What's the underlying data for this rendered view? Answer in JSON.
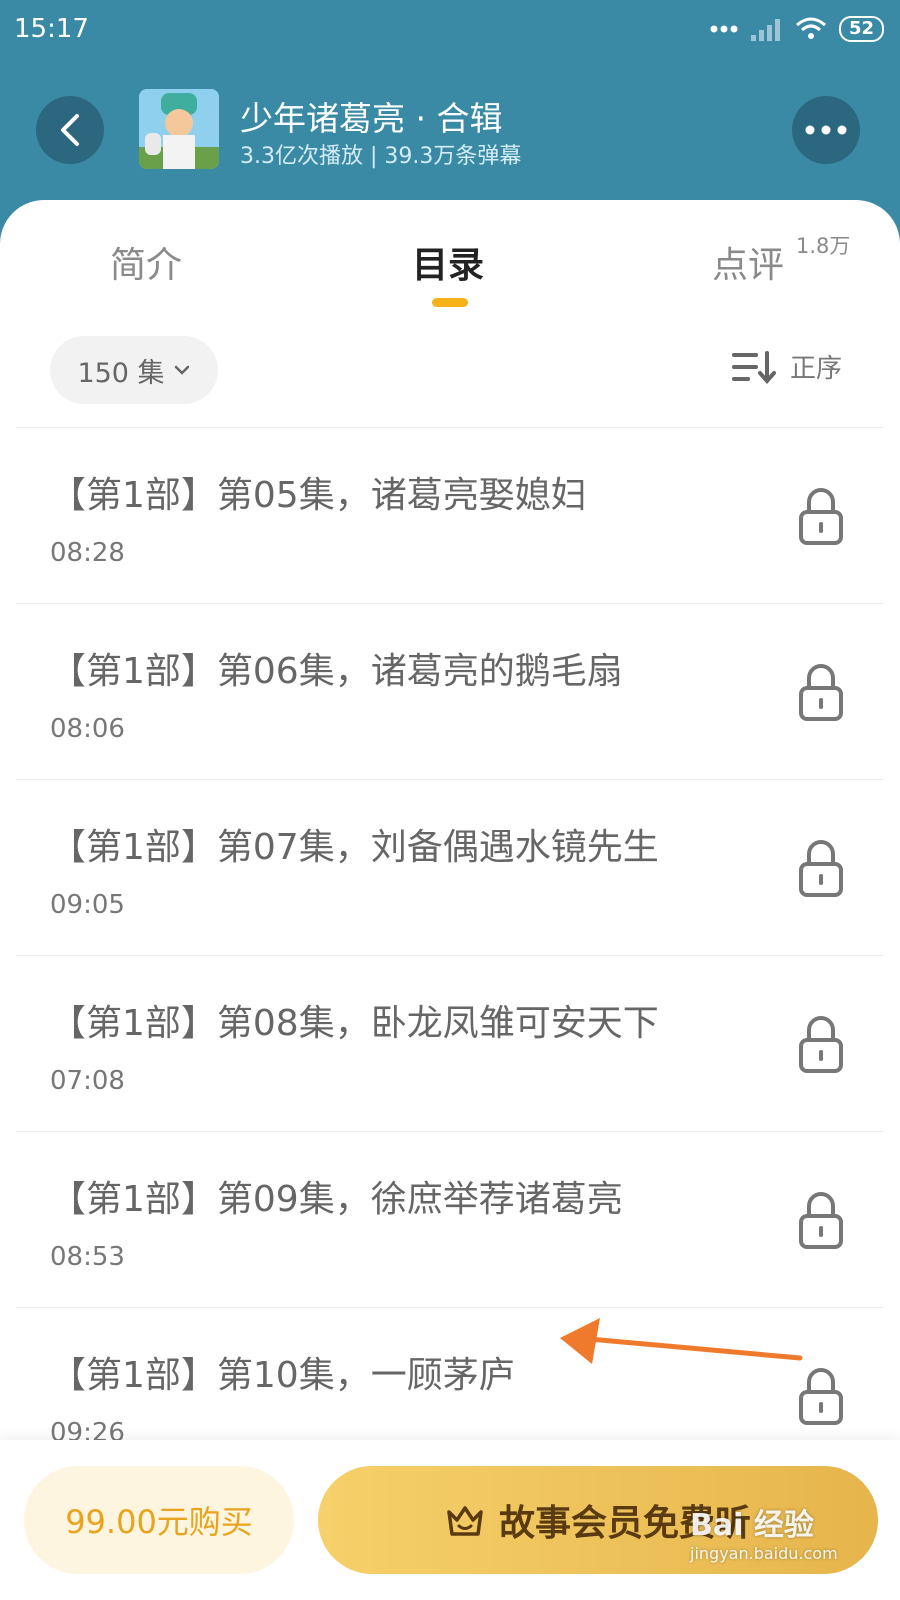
{
  "status_bar": {
    "time": "15:17",
    "battery": "52"
  },
  "header": {
    "title": "少年诸葛亮 · 合辑",
    "stats": "3.3亿次播放 | 39.3万条弹幕"
  },
  "tabs": {
    "intro": "简介",
    "catalog": "目录",
    "review": "点评",
    "review_count": "1.8万"
  },
  "toolbar": {
    "episode_count": "150 集",
    "sort_label": "正序"
  },
  "episodes": [
    {
      "title": "【第1部】第05集，诸葛亮娶媳妇",
      "duration": "08:28"
    },
    {
      "title": "【第1部】第06集，诸葛亮的鹅毛扇",
      "duration": "08:06"
    },
    {
      "title": "【第1部】第07集，刘备偶遇水镜先生",
      "duration": "09:05"
    },
    {
      "title": "【第1部】第08集，卧龙凤雏可安天下",
      "duration": "07:08"
    },
    {
      "title": "【第1部】第09集，徐庶举荐诸葛亮",
      "duration": "08:53"
    },
    {
      "title": "【第1部】第10集，一顾茅庐",
      "duration": "09:26"
    }
  ],
  "bottom": {
    "buy_label": "99.00元购买",
    "member_label": "故事会员免费听"
  },
  "watermark": {
    "main": "Bai 经验",
    "sub": "jingyan.baidu.com"
  },
  "colors": {
    "header_bg": "#3a8aa6",
    "accent": "#f7b21a",
    "annotation_arrow": "#f07a2c"
  }
}
